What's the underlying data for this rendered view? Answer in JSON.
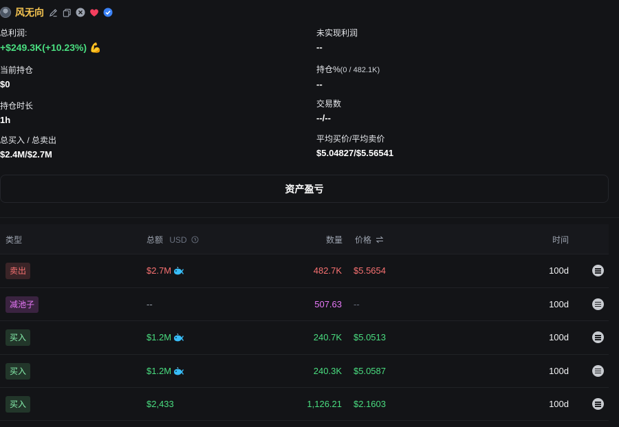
{
  "profile": {
    "name": "风无向"
  },
  "stats": {
    "total_profit_label": "总利润:",
    "total_profit_value": "+$249.3K(+10.23%)",
    "unrealized_label": "未实现利润",
    "unrealized_value": "--",
    "holding_label": "当前持仓",
    "holding_value": "$0",
    "holding_pct_label": "持仓%",
    "holding_pct_sub": "(0 / 482.1K)",
    "holding_pct_value": "--",
    "duration_label": "持仓时长",
    "duration_value": "1h",
    "trades_label": "交易数",
    "trades_value": "--/--",
    "buy_sell_label": "总买入 / 总卖出",
    "buy_sell_value": "$2.4M/$2.7M",
    "avg_price_label": "平均买价/平均卖价",
    "avg_price_value": "$5.04827/$5.56541"
  },
  "pnl_button": "资产盈亏",
  "table": {
    "headers": {
      "type": "类型",
      "amount": "总额",
      "amount_unit": "USD",
      "quantity": "数量",
      "price": "价格",
      "time": "时间"
    },
    "rows": [
      {
        "type": "卖出",
        "amount": "$2.7M",
        "quantity": "482.7K",
        "price": "$5.5654",
        "time": "100d"
      },
      {
        "type": "减池子",
        "amount": "--",
        "quantity": "507.63",
        "price": "--",
        "time": "100d"
      },
      {
        "type": "买入",
        "amount": "$1.2M",
        "quantity": "240.7K",
        "price": "$5.0513",
        "time": "100d"
      },
      {
        "type": "买入",
        "amount": "$1.2M",
        "quantity": "240.3K",
        "price": "$5.0587",
        "time": "100d"
      },
      {
        "type": "买入",
        "amount": "$2,433",
        "quantity": "1,126.21",
        "price": "$2.1603",
        "time": "100d"
      }
    ]
  },
  "colors": {
    "sell": "#f87171",
    "buy": "#4ade80",
    "pool": "#e879f9",
    "name": "#f5c451"
  },
  "icons": [
    "edit-icon",
    "copy-icon",
    "x-twitter-icon",
    "heart-icon",
    "verified-icon",
    "flex-emoji-icon",
    "whale-icon",
    "swap-icon",
    "info-circle-icon",
    "menu-icon"
  ]
}
